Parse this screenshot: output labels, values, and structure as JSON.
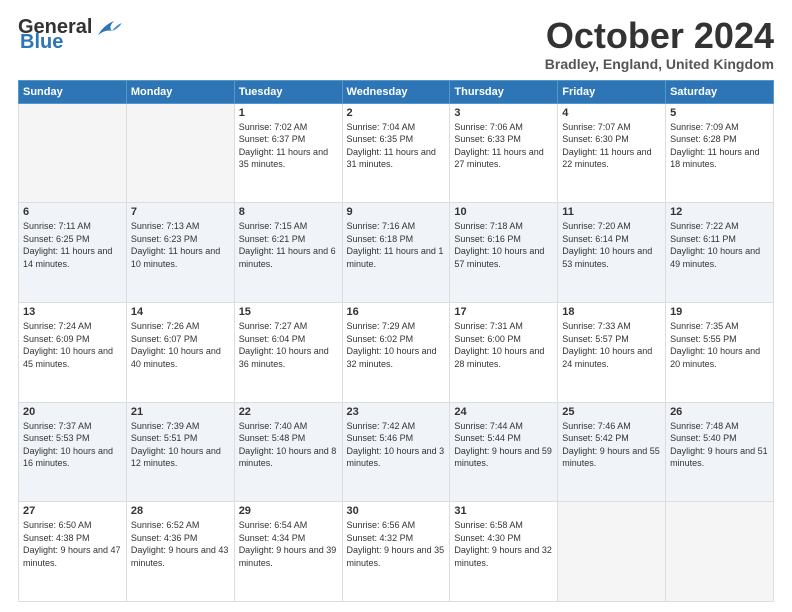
{
  "logo": {
    "line1": "General",
    "line2": "Blue"
  },
  "header": {
    "month": "October 2024",
    "location": "Bradley, England, United Kingdom"
  },
  "weekdays": [
    "Sunday",
    "Monday",
    "Tuesday",
    "Wednesday",
    "Thursday",
    "Friday",
    "Saturday"
  ],
  "weeks": [
    [
      {
        "day": "",
        "empty": true
      },
      {
        "day": "",
        "empty": true
      },
      {
        "day": "1",
        "sunrise": "Sunrise: 7:02 AM",
        "sunset": "Sunset: 6:37 PM",
        "daylight": "Daylight: 11 hours and 35 minutes."
      },
      {
        "day": "2",
        "sunrise": "Sunrise: 7:04 AM",
        "sunset": "Sunset: 6:35 PM",
        "daylight": "Daylight: 11 hours and 31 minutes."
      },
      {
        "day": "3",
        "sunrise": "Sunrise: 7:06 AM",
        "sunset": "Sunset: 6:33 PM",
        "daylight": "Daylight: 11 hours and 27 minutes."
      },
      {
        "day": "4",
        "sunrise": "Sunrise: 7:07 AM",
        "sunset": "Sunset: 6:30 PM",
        "daylight": "Daylight: 11 hours and 22 minutes."
      },
      {
        "day": "5",
        "sunrise": "Sunrise: 7:09 AM",
        "sunset": "Sunset: 6:28 PM",
        "daylight": "Daylight: 11 hours and 18 minutes."
      }
    ],
    [
      {
        "day": "6",
        "sunrise": "Sunrise: 7:11 AM",
        "sunset": "Sunset: 6:25 PM",
        "daylight": "Daylight: 11 hours and 14 minutes."
      },
      {
        "day": "7",
        "sunrise": "Sunrise: 7:13 AM",
        "sunset": "Sunset: 6:23 PM",
        "daylight": "Daylight: 11 hours and 10 minutes."
      },
      {
        "day": "8",
        "sunrise": "Sunrise: 7:15 AM",
        "sunset": "Sunset: 6:21 PM",
        "daylight": "Daylight: 11 hours and 6 minutes."
      },
      {
        "day": "9",
        "sunrise": "Sunrise: 7:16 AM",
        "sunset": "Sunset: 6:18 PM",
        "daylight": "Daylight: 11 hours and 1 minute."
      },
      {
        "day": "10",
        "sunrise": "Sunrise: 7:18 AM",
        "sunset": "Sunset: 6:16 PM",
        "daylight": "Daylight: 10 hours and 57 minutes."
      },
      {
        "day": "11",
        "sunrise": "Sunrise: 7:20 AM",
        "sunset": "Sunset: 6:14 PM",
        "daylight": "Daylight: 10 hours and 53 minutes."
      },
      {
        "day": "12",
        "sunrise": "Sunrise: 7:22 AM",
        "sunset": "Sunset: 6:11 PM",
        "daylight": "Daylight: 10 hours and 49 minutes."
      }
    ],
    [
      {
        "day": "13",
        "sunrise": "Sunrise: 7:24 AM",
        "sunset": "Sunset: 6:09 PM",
        "daylight": "Daylight: 10 hours and 45 minutes."
      },
      {
        "day": "14",
        "sunrise": "Sunrise: 7:26 AM",
        "sunset": "Sunset: 6:07 PM",
        "daylight": "Daylight: 10 hours and 40 minutes."
      },
      {
        "day": "15",
        "sunrise": "Sunrise: 7:27 AM",
        "sunset": "Sunset: 6:04 PM",
        "daylight": "Daylight: 10 hours and 36 minutes."
      },
      {
        "day": "16",
        "sunrise": "Sunrise: 7:29 AM",
        "sunset": "Sunset: 6:02 PM",
        "daylight": "Daylight: 10 hours and 32 minutes."
      },
      {
        "day": "17",
        "sunrise": "Sunrise: 7:31 AM",
        "sunset": "Sunset: 6:00 PM",
        "daylight": "Daylight: 10 hours and 28 minutes."
      },
      {
        "day": "18",
        "sunrise": "Sunrise: 7:33 AM",
        "sunset": "Sunset: 5:57 PM",
        "daylight": "Daylight: 10 hours and 24 minutes."
      },
      {
        "day": "19",
        "sunrise": "Sunrise: 7:35 AM",
        "sunset": "Sunset: 5:55 PM",
        "daylight": "Daylight: 10 hours and 20 minutes."
      }
    ],
    [
      {
        "day": "20",
        "sunrise": "Sunrise: 7:37 AM",
        "sunset": "Sunset: 5:53 PM",
        "daylight": "Daylight: 10 hours and 16 minutes."
      },
      {
        "day": "21",
        "sunrise": "Sunrise: 7:39 AM",
        "sunset": "Sunset: 5:51 PM",
        "daylight": "Daylight: 10 hours and 12 minutes."
      },
      {
        "day": "22",
        "sunrise": "Sunrise: 7:40 AM",
        "sunset": "Sunset: 5:48 PM",
        "daylight": "Daylight: 10 hours and 8 minutes."
      },
      {
        "day": "23",
        "sunrise": "Sunrise: 7:42 AM",
        "sunset": "Sunset: 5:46 PM",
        "daylight": "Daylight: 10 hours and 3 minutes."
      },
      {
        "day": "24",
        "sunrise": "Sunrise: 7:44 AM",
        "sunset": "Sunset: 5:44 PM",
        "daylight": "Daylight: 9 hours and 59 minutes."
      },
      {
        "day": "25",
        "sunrise": "Sunrise: 7:46 AM",
        "sunset": "Sunset: 5:42 PM",
        "daylight": "Daylight: 9 hours and 55 minutes."
      },
      {
        "day": "26",
        "sunrise": "Sunrise: 7:48 AM",
        "sunset": "Sunset: 5:40 PM",
        "daylight": "Daylight: 9 hours and 51 minutes."
      }
    ],
    [
      {
        "day": "27",
        "sunrise": "Sunrise: 6:50 AM",
        "sunset": "Sunset: 4:38 PM",
        "daylight": "Daylight: 9 hours and 47 minutes."
      },
      {
        "day": "28",
        "sunrise": "Sunrise: 6:52 AM",
        "sunset": "Sunset: 4:36 PM",
        "daylight": "Daylight: 9 hours and 43 minutes."
      },
      {
        "day": "29",
        "sunrise": "Sunrise: 6:54 AM",
        "sunset": "Sunset: 4:34 PM",
        "daylight": "Daylight: 9 hours and 39 minutes."
      },
      {
        "day": "30",
        "sunrise": "Sunrise: 6:56 AM",
        "sunset": "Sunset: 4:32 PM",
        "daylight": "Daylight: 9 hours and 35 minutes."
      },
      {
        "day": "31",
        "sunrise": "Sunrise: 6:58 AM",
        "sunset": "Sunset: 4:30 PM",
        "daylight": "Daylight: 9 hours and 32 minutes."
      },
      {
        "day": "",
        "empty": true
      },
      {
        "day": "",
        "empty": true
      }
    ]
  ]
}
